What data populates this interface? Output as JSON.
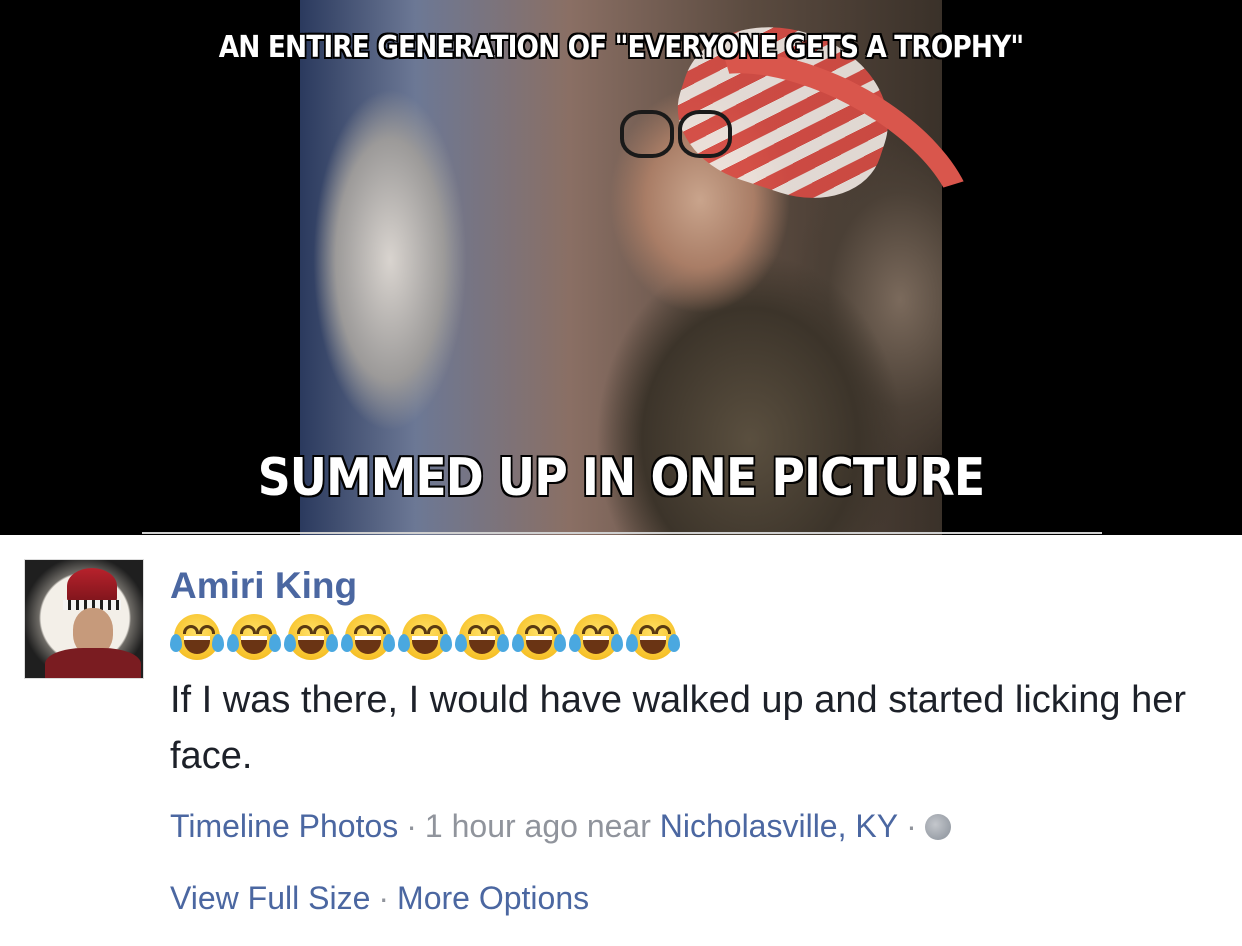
{
  "meme": {
    "top_caption": "AN ENTIRE GENERATION OF \"EVERYONE GETS A TROPHY\"",
    "bottom_caption": "SUMMED UP IN ONE PICTURE"
  },
  "post": {
    "author": "Amiri King",
    "emoji_count": 9,
    "emoji_icon": "face-with-tears-of-joy-icon",
    "text": "If I was there, I would have walked up and started licking her face."
  },
  "meta": {
    "source_link": "Timeline Photos",
    "separator": "·",
    "time": "1 hour ago",
    "near_label": "near",
    "location": "Nicholasville, KY",
    "privacy_icon": "globe-icon"
  },
  "actions": {
    "view_full_size": "View Full Size",
    "more_options": "More Options"
  },
  "colors": {
    "link": "#4b67a1",
    "muted": "#90949c",
    "text": "#1d2129"
  }
}
